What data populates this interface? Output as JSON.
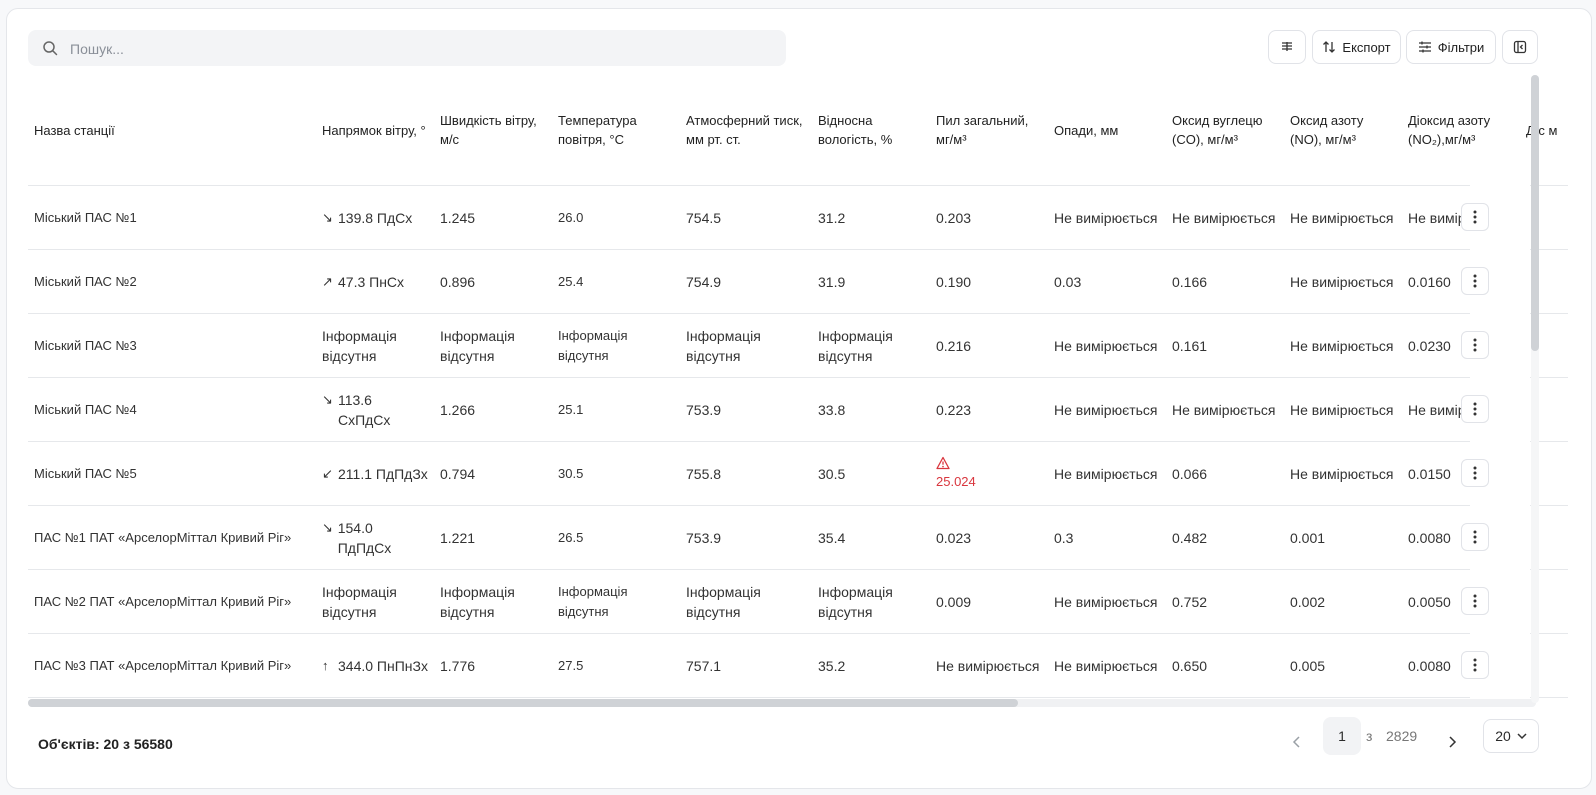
{
  "search": {
    "placeholder": "Пошук..."
  },
  "toolbar": {
    "columns_icon": "columns-icon",
    "export_label": "Експорт",
    "filters_label": "Фільтри",
    "panel_icon": "panel-collapse-icon"
  },
  "table": {
    "headers": [
      "Назва станції",
      "Напрямок вітру, °",
      "Швидкість вітру, м/с",
      "Температура повітря, °C",
      "Атмосферний тиск, мм рт. ст.",
      "Відносна вологість, %",
      "Пил загальний, мг/м³",
      "Опади, мм",
      "Оксид вуглецю (CO), мг/м³",
      "Оксид азоту (NO), мг/м³",
      "Діоксид азоту (NO₂),мг/м³",
      "Д с м"
    ],
    "rows": [
      {
        "station": "Міський ПАС №1",
        "arrow": "↘",
        "wind_dir": "139.8 ПдСх",
        "wind_speed": "1.245",
        "temp": "26.0",
        "pressure": "754.5",
        "humidity": "31.2",
        "dust": "0.203",
        "precip": "Не вимірюється",
        "co": "Не вимірюється",
        "no": "Не вимірюється",
        "no2": "Не вимірк"
      },
      {
        "station": "Міський ПАС №2",
        "arrow": "↗",
        "wind_dir": "47.3 ПнСх",
        "wind_speed": "0.896",
        "temp": "25.4",
        "pressure": "754.9",
        "humidity": "31.9",
        "dust": "0.190",
        "precip": "0.03",
        "co": "0.166",
        "no": "Не вимірюється",
        "no2": "0.0160"
      },
      {
        "station": "Міський ПАС №3",
        "arrow": "",
        "wind_dir": "Інформація відсутня",
        "wind_speed": "Інформація відсутня",
        "temp": "Інформація відсутня",
        "pressure": "Інформація відсутня",
        "humidity": "Інформація відсутня",
        "dust": "0.216",
        "precip": "Не вимірюється",
        "co": "0.161",
        "no": "Не вимірюється",
        "no2": "0.0230"
      },
      {
        "station": "Міський ПАС №4",
        "arrow": "↘",
        "wind_dir": "113.6 СхПдСх",
        "wind_speed": "1.266",
        "temp": "25.1",
        "pressure": "753.9",
        "humidity": "33.8",
        "dust": "0.223",
        "precip": "Не вимірюється",
        "co": "Не вимірюється",
        "no": "Не вимірюється",
        "no2": "Не вимірк"
      },
      {
        "station": "Міський ПАС №5",
        "arrow": "↙",
        "wind_dir": "211.1 ПдПдЗх",
        "wind_speed": "0.794",
        "temp": "30.5",
        "pressure": "755.8",
        "humidity": "30.5",
        "dust": "25.024",
        "dust_warning": true,
        "precip": "Не вимірюється",
        "co": "0.066",
        "no": "Не вимірюється",
        "no2": "0.0150"
      },
      {
        "station": "ПАС №1 ПАТ «АрселорМіттал Кривий Ріг»",
        "arrow": "↘",
        "wind_dir": "154.0 ПдПдСх",
        "wind_speed": "1.221",
        "temp": "26.5",
        "pressure": "753.9",
        "humidity": "35.4",
        "dust": "0.023",
        "precip": "0.3",
        "co": "0.482",
        "no": "0.001",
        "no2": "0.0080"
      },
      {
        "station": "ПАС №2 ПАТ «АрселорМіттал Кривий Ріг»",
        "arrow": "",
        "wind_dir": "Інформація відсутня",
        "wind_speed": "Інформація відсутня",
        "temp": "Інформація відсутня",
        "pressure": "Інформація відсутня",
        "humidity": "Інформація відсутня",
        "dust": "0.009",
        "precip": "Не вимірюється",
        "co": "0.752",
        "no": "0.002",
        "no2": "0.0050"
      },
      {
        "station": "ПАС №3 ПАТ «АрселорМіттал Кривий Ріг»",
        "arrow": "↑",
        "wind_dir": "344.0 ПнПнЗх",
        "wind_speed": "1.776",
        "temp": "27.5",
        "pressure": "757.1",
        "humidity": "35.2",
        "dust": "Не вимірюється",
        "precip": "Не вимірюється",
        "co": "0.650",
        "no": "0.005",
        "no2": "0.0080"
      }
    ]
  },
  "footer": {
    "count": "Об'єктів: 20 з 56580",
    "current_page": "1",
    "of_label": "з",
    "total_pages": "2829",
    "page_size": "20"
  },
  "colors": {
    "warning": "#d9363e",
    "border": "#e6e8eb"
  }
}
